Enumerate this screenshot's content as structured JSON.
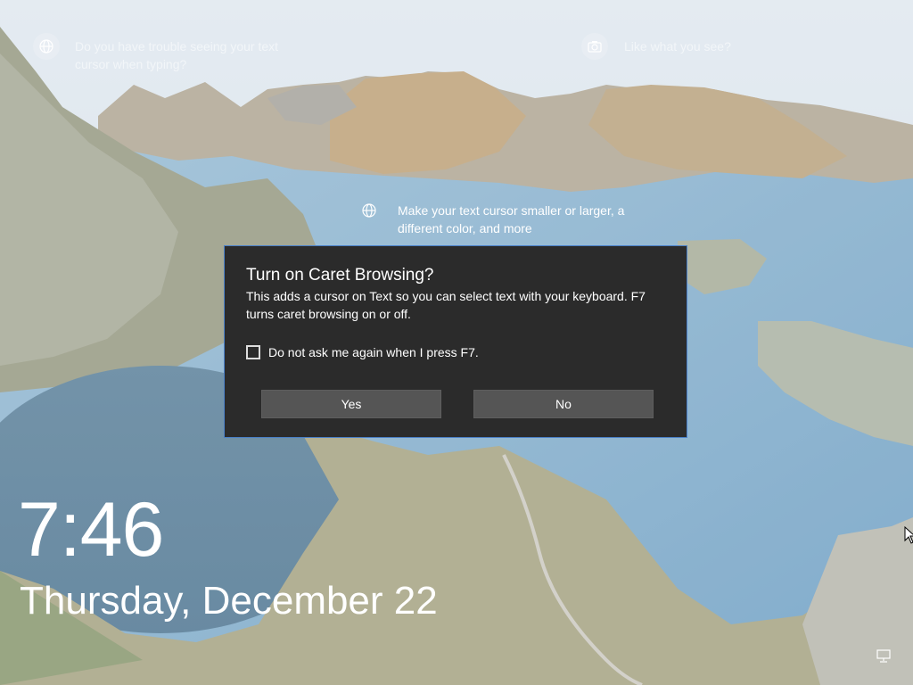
{
  "lockscreen": {
    "tip_left": "Do you have trouble seeing your text cursor when typing?",
    "tip_right": "Like what you see?",
    "tip_center": "Make your text cursor smaller or larger, a different color, and more",
    "time": "7:46",
    "date": "Thursday, December 22"
  },
  "dialog": {
    "title": "Turn on Caret Browsing?",
    "body": "This adds a cursor on Text so you can select text with your keyboard. F7 turns caret browsing on or off.",
    "checkbox_label": "Do not ask me again when I press F7.",
    "checkbox_checked": false,
    "yes_label": "Yes",
    "no_label": "No"
  },
  "icons": {
    "tip_left": "globe-icon",
    "tip_right": "camera-icon",
    "tip_center": "globe-icon",
    "tray": "network-icon"
  },
  "colors": {
    "dialog_bg": "#2b2b2b",
    "dialog_border": "#4a80c8",
    "button_bg": "#555555"
  }
}
